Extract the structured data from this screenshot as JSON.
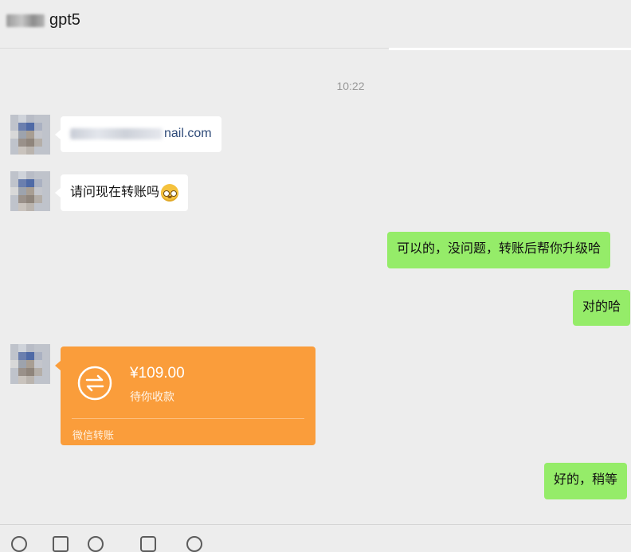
{
  "header": {
    "title": "gpt5",
    "name_blurred": true
  },
  "chat": {
    "timestamp": "10:22",
    "messages": [
      {
        "side": "left",
        "type": "text",
        "text": "nail.com",
        "prefix_blurred": true
      },
      {
        "side": "left",
        "type": "text",
        "text": "请问现在转账吗",
        "emoji": "smile-emoji-icon"
      },
      {
        "side": "right",
        "type": "text",
        "text": "可以的，没问题，转账后帮你升级哈"
      },
      {
        "side": "right",
        "type": "text",
        "text": "对的哈"
      },
      {
        "side": "left",
        "type": "transfer",
        "amount": "¥109.00",
        "status": "待你收款",
        "label": "微信转账",
        "icon": "transfer-arrows-icon"
      },
      {
        "side": "right",
        "type": "text",
        "text": "好的，稍等"
      }
    ]
  },
  "colors": {
    "background": "#ededed",
    "self_bubble": "#95ec69",
    "other_bubble": "#ffffff",
    "transfer_card": "#fa9d3b"
  },
  "toolbar": {
    "icons": [
      "emoji-icon",
      "folder-icon",
      "scissors-icon",
      "chat-history-icon",
      "voice-call-icon"
    ]
  }
}
